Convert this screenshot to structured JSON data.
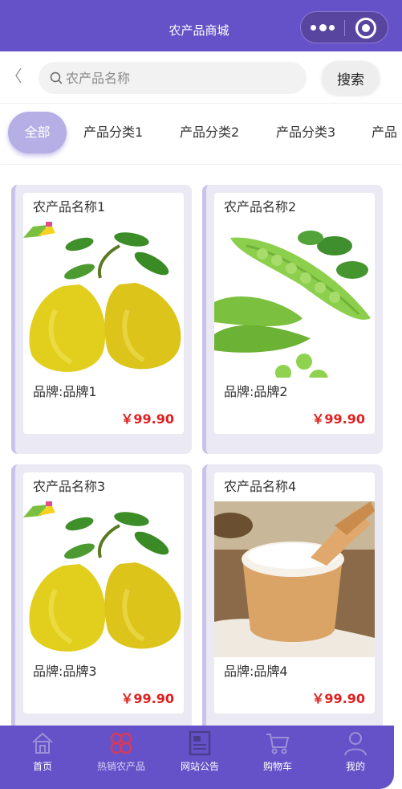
{
  "navbar": {
    "title": "农产品商城"
  },
  "search": {
    "placeholder": "农产品名称",
    "button_label": "搜索"
  },
  "categories": [
    {
      "label": "全部",
      "active": true
    },
    {
      "label": "产品分类1",
      "active": false
    },
    {
      "label": "产品分类2",
      "active": false
    },
    {
      "label": "产品分类3",
      "active": false
    },
    {
      "label": "产品",
      "active": false
    }
  ],
  "products": [
    {
      "name": "农产品名称1",
      "brand": "品牌:品牌1",
      "price": "￥99.90",
      "image": "pomelo-image"
    },
    {
      "name": "农产品名称2",
      "brand": "品牌:品牌2",
      "price": "￥99.90",
      "image": "peas-image"
    },
    {
      "name": "农产品名称3",
      "brand": "品牌:品牌3",
      "price": "￥99.90",
      "image": "pomelo-image"
    },
    {
      "name": "农产品名称4",
      "brand": "品牌:品牌4",
      "price": "￥99.90",
      "image": "rice-image"
    }
  ],
  "tabbar": [
    {
      "label": "首页",
      "icon": "home-icon",
      "active": false
    },
    {
      "label": "热销农产品",
      "icon": "hot-products-icon",
      "active": true
    },
    {
      "label": "网站公告",
      "icon": "notice-icon",
      "active": false
    },
    {
      "label": "购物车",
      "icon": "cart-icon",
      "active": false
    },
    {
      "label": "我的",
      "icon": "user-icon",
      "active": false
    }
  ],
  "colors": {
    "brand": "#6652c8",
    "price": "#e02020",
    "card_bg": "#ebe9f4",
    "active_tab": "#b6afe6"
  }
}
